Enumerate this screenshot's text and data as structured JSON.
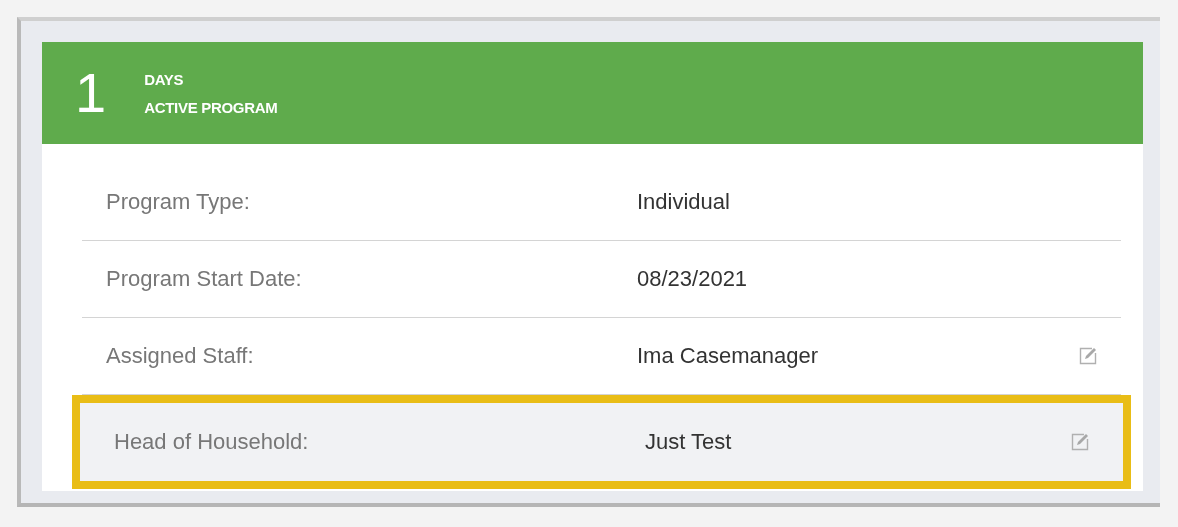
{
  "header": {
    "count": "1",
    "unit": "DAYS",
    "status": "ACTIVE PROGRAM"
  },
  "rows": [
    {
      "label": "Program Type:",
      "value": "Individual",
      "editable": false,
      "highlighted": false
    },
    {
      "label": "Program Start Date:",
      "value": "08/23/2021",
      "editable": false,
      "highlighted": false
    },
    {
      "label": "Assigned Staff:",
      "value": "Ima Casemanager",
      "editable": true,
      "highlighted": false
    },
    {
      "label": "Head of Household:",
      "value": "Just Test",
      "editable": true,
      "highlighted": true
    }
  ]
}
